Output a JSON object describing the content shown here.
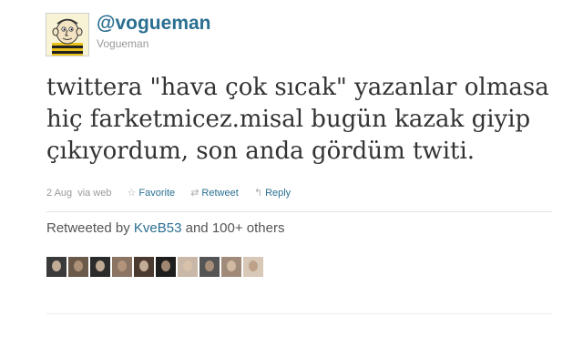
{
  "tweet": {
    "username": "@vogueman",
    "fullname": "Vogueman",
    "text_lines": [
      "twittera \"hava çok sıcak\" yazanlar olmasa",
      "hiç farketmicez.misal bugün kazak giyip",
      "çıkıyordum, son anda gördüm twiti."
    ],
    "timestamp": "2 Aug",
    "via_label": "via",
    "source": "web",
    "actions": {
      "favorite": "Favorite",
      "retweet": "Retweet",
      "reply": "Reply"
    }
  },
  "retweets": {
    "prefix": "Retweeted by",
    "user": "KveB53",
    "suffix": "and 100+ others",
    "face_colors": [
      "#3a3a3a",
      "#6b5a4a",
      "#2b2b2b",
      "#8a7565",
      "#4a3a30",
      "#1e1e1e",
      "#c9b8a8",
      "#555555",
      "#a08b7a",
      "#d8c8b8"
    ]
  },
  "colors": {
    "link": "#2a6f91",
    "text": "#333333",
    "muted": "#999999"
  }
}
